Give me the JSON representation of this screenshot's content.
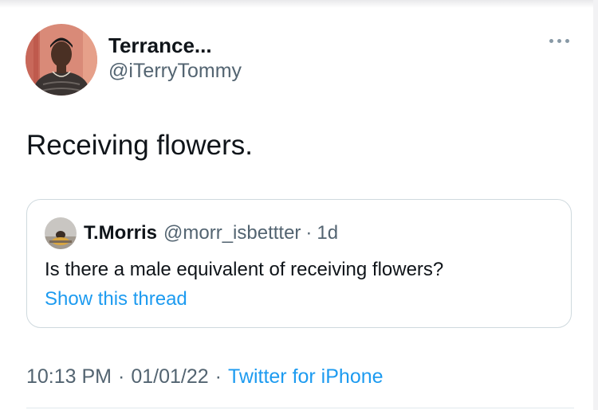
{
  "author": {
    "display_name": "Terrance...",
    "handle": "@iTerryTommy"
  },
  "tweet": {
    "text": "Receiving flowers."
  },
  "quoted_tweet": {
    "display_name": "T.Morris",
    "handle": "@morr_isbettter",
    "separator": "·",
    "time": "1d",
    "text": "Is there a male equivalent of receiving flowers?",
    "link_label": "Show this thread"
  },
  "meta": {
    "time": "10:13 PM",
    "separator": "·",
    "date": "01/01/22",
    "source": "Twitter for iPhone"
  },
  "colors": {
    "text": "#0f1419",
    "secondary": "#536471",
    "link": "#1d9bf0",
    "border": "#cfd9de"
  },
  "icons": {
    "more": "more-horizontal-icon"
  }
}
